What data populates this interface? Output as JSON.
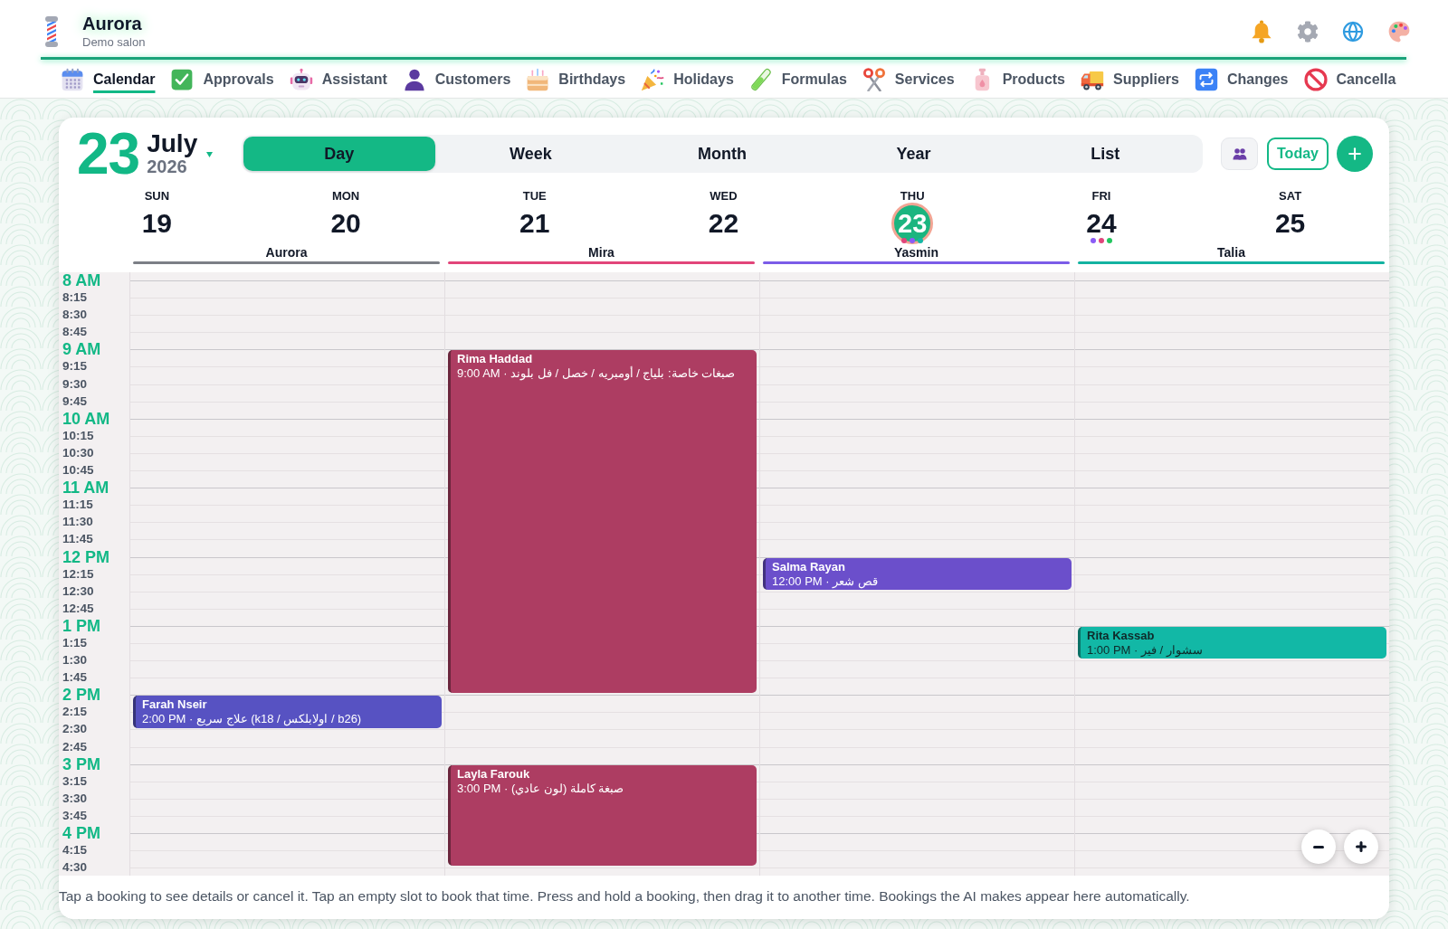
{
  "app": {
    "name": "Aurora",
    "subtitle": "Demo salon"
  },
  "nav": [
    {
      "label": "Calendar",
      "selected": true
    },
    {
      "label": "Approvals",
      "selected": false
    },
    {
      "label": "Assistant",
      "selected": false
    },
    {
      "label": "Customers",
      "selected": false
    },
    {
      "label": "Birthdays",
      "selected": false
    },
    {
      "label": "Holidays",
      "selected": false
    },
    {
      "label": "Formulas",
      "selected": false
    },
    {
      "label": "Services",
      "selected": false
    },
    {
      "label": "Products",
      "selected": false
    },
    {
      "label": "Suppliers",
      "selected": false
    },
    {
      "label": "Changes",
      "selected": false
    },
    {
      "label": "Cancella",
      "selected": false
    }
  ],
  "date": {
    "day": "23",
    "month": "July",
    "year": "2026"
  },
  "views": [
    {
      "label": "Day",
      "selected": true
    },
    {
      "label": "Week",
      "selected": false
    },
    {
      "label": "Month",
      "selected": false
    },
    {
      "label": "Year",
      "selected": false
    },
    {
      "label": "List",
      "selected": false
    }
  ],
  "today_button": "Today",
  "days": [
    {
      "weekday": "SUN",
      "date": "19",
      "today": false
    },
    {
      "weekday": "MON",
      "date": "20",
      "today": false
    },
    {
      "weekday": "TUE",
      "date": "21",
      "today": false
    },
    {
      "weekday": "WED",
      "date": "22",
      "today": false
    },
    {
      "weekday": "THU",
      "date": "23",
      "today": true,
      "dots": [
        {
          "color": "#e0457b"
        },
        {
          "color": "#8b5cf6"
        },
        {
          "color": "#14b8a6"
        }
      ]
    },
    {
      "weekday": "FRI",
      "date": "24",
      "today": false,
      "dots": [
        {
          "color": "#8b5cf6"
        },
        {
          "color": "#e0457b"
        },
        {
          "color": "#22c55e"
        }
      ]
    },
    {
      "weekday": "SAT",
      "date": "25",
      "today": false
    }
  ],
  "staff": [
    {
      "name": "Aurora",
      "color": "#7c7f86",
      "slots": [
        {
          "kind": "free"
        },
        {
          "kind": "free"
        },
        {
          "kind": "free"
        },
        {
          "kind": "free"
        },
        {
          "kind": "free"
        },
        {
          "kind": "free"
        },
        {
          "kind": "free"
        },
        {
          "kind": "free"
        },
        {
          "kind": "free"
        },
        {
          "kind": "free"
        },
        {
          "kind": "free"
        },
        {
          "kind": "free"
        },
        {
          "kind": "free"
        },
        {
          "kind": "free"
        },
        {
          "kind": "free"
        },
        {
          "kind": "free"
        },
        {
          "kind": "free"
        },
        {
          "kind": "free"
        },
        {
          "kind": "free"
        },
        {
          "kind": "free"
        },
        {
          "kind": "free"
        },
        {
          "kind": "free"
        },
        {
          "kind": "free"
        },
        {
          "kind": "free"
        },
        {
          "kind": "booking",
          "name": "Farah Nseir",
          "detail": "2:00 PM · علاج سريع (k18 / اولابلكس / b26)",
          "color": "#5752c2"
        },
        {
          "kind": "continued"
        },
        {
          "kind": "free"
        },
        {
          "kind": "free"
        },
        {
          "kind": "free"
        },
        {
          "kind": "free"
        },
        {
          "kind": "free"
        },
        {
          "kind": "free"
        },
        {
          "kind": "free"
        },
        {
          "kind": "free"
        },
        {
          "kind": "free"
        }
      ]
    },
    {
      "name": "Mira",
      "color": "#e2457a",
      "slots": [
        {
          "kind": "free"
        },
        {
          "kind": "free"
        },
        {
          "kind": "free"
        },
        {
          "kind": "free"
        },
        {
          "kind": "booking",
          "name": "Rima Haddad",
          "detail": "9:00 AM · صبغات خاصة: بلياج / أومبريه / خصل / فل بلوند",
          "color": "#ad3d62"
        },
        {
          "kind": "continued"
        },
        {
          "kind": "continued"
        },
        {
          "kind": "continued"
        },
        {
          "kind": "continued"
        },
        {
          "kind": "continued"
        },
        {
          "kind": "continued"
        },
        {
          "kind": "continued"
        },
        {
          "kind": "continued"
        },
        {
          "kind": "continued"
        },
        {
          "kind": "continued"
        },
        {
          "kind": "continued"
        },
        {
          "kind": "continued"
        },
        {
          "kind": "continued"
        },
        {
          "kind": "continued"
        },
        {
          "kind": "continued"
        },
        {
          "kind": "continued"
        },
        {
          "kind": "continued"
        },
        {
          "kind": "continued"
        },
        {
          "kind": "continued"
        },
        {
          "kind": "free"
        },
        {
          "kind": "free"
        },
        {
          "kind": "free"
        },
        {
          "kind": "free"
        },
        {
          "kind": "booking",
          "name": "Layla Farouk",
          "detail": "3:00 PM · صبغة كاملة (لون عادي)",
          "color": "#ad3d62"
        },
        {
          "kind": "continued"
        },
        {
          "kind": "continued"
        },
        {
          "kind": "continued"
        },
        {
          "kind": "continued"
        },
        {
          "kind": "continued"
        },
        {
          "kind": "free"
        }
      ]
    },
    {
      "name": "Yasmin",
      "color": "#7b5ce8",
      "slots": [
        {
          "kind": "free"
        },
        {
          "kind": "free"
        },
        {
          "kind": "free"
        },
        {
          "kind": "free"
        },
        {
          "kind": "free"
        },
        {
          "kind": "free"
        },
        {
          "kind": "free"
        },
        {
          "kind": "free"
        },
        {
          "kind": "free"
        },
        {
          "kind": "free"
        },
        {
          "kind": "free"
        },
        {
          "kind": "free"
        },
        {
          "kind": "free"
        },
        {
          "kind": "free"
        },
        {
          "kind": "free"
        },
        {
          "kind": "free"
        },
        {
          "kind": "booking",
          "name": "Salma Rayan",
          "detail": "12:00 PM · قص شعر",
          "color": "#6b4fcb"
        },
        {
          "kind": "continued"
        },
        {
          "kind": "free"
        },
        {
          "kind": "free"
        },
        {
          "kind": "free"
        },
        {
          "kind": "free"
        },
        {
          "kind": "free"
        },
        {
          "kind": "free"
        },
        {
          "kind": "free"
        },
        {
          "kind": "free"
        },
        {
          "kind": "free"
        },
        {
          "kind": "free"
        },
        {
          "kind": "free"
        },
        {
          "kind": "free"
        },
        {
          "kind": "free"
        },
        {
          "kind": "free"
        },
        {
          "kind": "free"
        },
        {
          "kind": "free"
        },
        {
          "kind": "free"
        }
      ]
    },
    {
      "name": "Talia",
      "color": "#13b3a1",
      "slots": [
        {
          "kind": "free"
        },
        {
          "kind": "free"
        },
        {
          "kind": "free"
        },
        {
          "kind": "free"
        },
        {
          "kind": "free"
        },
        {
          "kind": "free"
        },
        {
          "kind": "free"
        },
        {
          "kind": "free"
        },
        {
          "kind": "free"
        },
        {
          "kind": "free"
        },
        {
          "kind": "free"
        },
        {
          "kind": "free"
        },
        {
          "kind": "free"
        },
        {
          "kind": "free"
        },
        {
          "kind": "free"
        },
        {
          "kind": "free"
        },
        {
          "kind": "free"
        },
        {
          "kind": "free"
        },
        {
          "kind": "free"
        },
        {
          "kind": "free"
        },
        {
          "kind": "booking",
          "name": "Rita Kassab",
          "detail": "1:00 PM · سشوار / فير",
          "color": "#12b8a6"
        },
        {
          "kind": "continued"
        },
        {
          "kind": "free"
        },
        {
          "kind": "free"
        },
        {
          "kind": "free"
        },
        {
          "kind": "free"
        },
        {
          "kind": "free"
        },
        {
          "kind": "free"
        },
        {
          "kind": "free"
        },
        {
          "kind": "free"
        },
        {
          "kind": "free"
        },
        {
          "kind": "free"
        },
        {
          "kind": "free"
        },
        {
          "kind": "free"
        },
        {
          "kind": "free"
        }
      ]
    }
  ],
  "time_slots": [
    {
      "label": "8 AM",
      "kind": "hour"
    },
    {
      "label": "8:15",
      "kind": "quarter"
    },
    {
      "label": "8:30",
      "kind": "quarter"
    },
    {
      "label": "8:45",
      "kind": "quarter"
    },
    {
      "label": "9 AM",
      "kind": "hour"
    },
    {
      "label": "9:15",
      "kind": "quarter"
    },
    {
      "label": "9:30",
      "kind": "quarter"
    },
    {
      "label": "9:45",
      "kind": "quarter"
    },
    {
      "label": "10 AM",
      "kind": "hour"
    },
    {
      "label": "10:15",
      "kind": "quarter"
    },
    {
      "label": "10:30",
      "kind": "quarter"
    },
    {
      "label": "10:45",
      "kind": "quarter"
    },
    {
      "label": "11 AM",
      "kind": "hour"
    },
    {
      "label": "11:15",
      "kind": "quarter"
    },
    {
      "label": "11:30",
      "kind": "quarter"
    },
    {
      "label": "11:45",
      "kind": "quarter"
    },
    {
      "label": "12 PM",
      "kind": "hour"
    },
    {
      "label": "12:15",
      "kind": "quarter"
    },
    {
      "label": "12:30",
      "kind": "quarter"
    },
    {
      "label": "12:45",
      "kind": "quarter"
    },
    {
      "label": "1 PM",
      "kind": "hour"
    },
    {
      "label": "1:15",
      "kind": "quarter"
    },
    {
      "label": "1:30",
      "kind": "quarter"
    },
    {
      "label": "1:45",
      "kind": "quarter"
    },
    {
      "label": "2 PM",
      "kind": "hour"
    },
    {
      "label": "2:15",
      "kind": "quarter"
    },
    {
      "label": "2:30",
      "kind": "quarter"
    },
    {
      "label": "2:45",
      "kind": "quarter"
    },
    {
      "label": "3 PM",
      "kind": "hour"
    },
    {
      "label": "3:15",
      "kind": "quarter"
    },
    {
      "label": "3:30",
      "kind": "quarter"
    },
    {
      "label": "3:45",
      "kind": "quarter"
    },
    {
      "label": "4 PM",
      "kind": "hour"
    },
    {
      "label": "4:15",
      "kind": "quarter"
    },
    {
      "label": "4:30",
      "kind": "quarter"
    }
  ],
  "help_text": "Tap a booking to see details or cancel it. Tap an empty slot to book that time. Press and hold a booking, then drag it to another time. Bookings the AI makes appear here automatically."
}
